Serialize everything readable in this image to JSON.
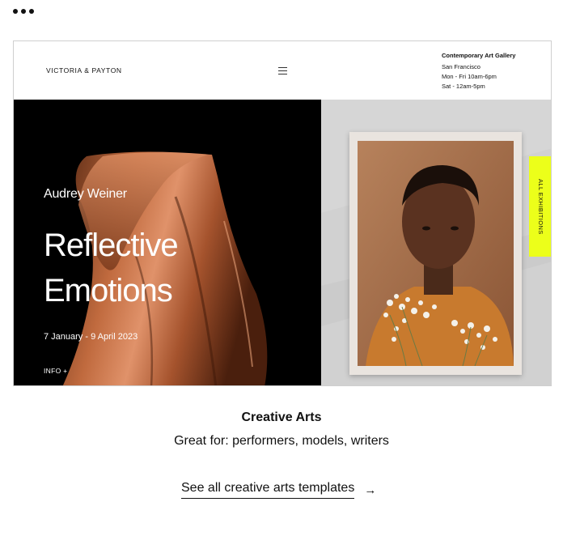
{
  "preview": {
    "brand": "VICTORIA & PAYTON",
    "gallery_name": "Contemporary Art Gallery",
    "city": "San Francisco",
    "hours_weekday": "Mon - Fri 10am-6pm",
    "hours_saturday": "Sat - 12am-5pm",
    "artist": "Audrey Weiner",
    "title_line1": "Reflective",
    "title_line2": "Emotions",
    "dates": "7 January - 9 April 2023",
    "info_link": "INFO +",
    "exhibitions_tab": "ALL EXHIBITIONS"
  },
  "caption": {
    "title": "Creative Arts",
    "subtitle": "Great for: performers, models, writers"
  },
  "cta": {
    "label": "See all creative arts templates",
    "arrow": "→"
  },
  "colors": {
    "accent_yellow": "#ecff1a",
    "hero_black": "#000000",
    "copper": "#b8623a"
  },
  "icons": [
    "more-dots-icon",
    "hamburger-menu-icon",
    "arrow-right-icon"
  ]
}
